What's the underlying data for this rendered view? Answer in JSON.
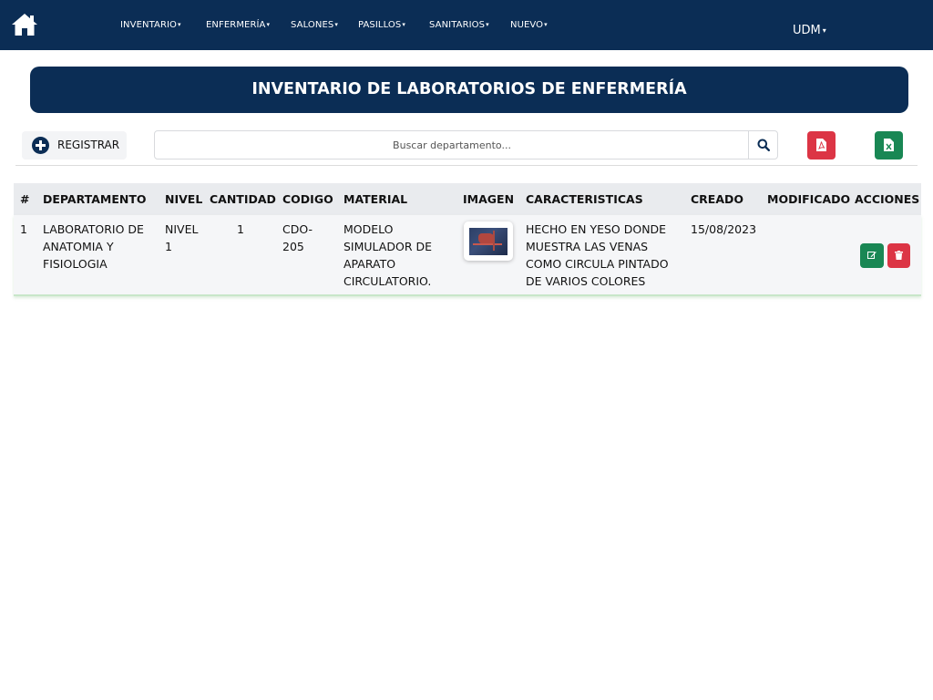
{
  "navbar": {
    "home_icon": "home-icon",
    "items": [
      {
        "label": "INVENTARIO"
      },
      {
        "label": "ENFERMERÍA"
      },
      {
        "label": "SALONES"
      },
      {
        "label": "PASILLOS"
      },
      {
        "label": "SANITARIOS"
      },
      {
        "label": "NUEVO"
      }
    ],
    "user": "UDM",
    "caret": "▾"
  },
  "banner": {
    "title": "INVENTARIO DE LABORATORIOS DE ENFERMERÍA"
  },
  "toolbar": {
    "register_label": "REGISTRAR",
    "register_icon": "plus-circle-icon",
    "search_placeholder": "Buscar departamento...",
    "search_icon": "search-icon",
    "pdf_icon": "file-pdf-icon",
    "excel_icon": "file-excel-icon"
  },
  "table": {
    "headers": [
      "#",
      "DEPARTAMENTO",
      "NIVEL",
      "CANTIDAD",
      "CODIGO",
      "MATERIAL",
      "IMAGEN",
      "CARACTERISTICAS",
      "CREADO",
      "MODIFICADO",
      "ACCIONES"
    ],
    "rows": [
      {
        "index": "1",
        "departamento": [
          "LABORATORIO DE",
          "ANATOMIA Y",
          "FISIOLOGIA"
        ],
        "nivel": [
          "NIVEL",
          "1"
        ],
        "cantidad": "1",
        "codigo": [
          "CDO-",
          "205"
        ],
        "material": [
          "MODELO",
          "SIMULADOR DE",
          "APARATO",
          "CIRCULATORIO."
        ],
        "imagen": "circulatory-model-thumbnail",
        "caracteristicas": [
          "HECHO EN YESO DONDE",
          "MUESTRA LAS VENAS",
          "COMO CIRCULA PINTADO",
          "DE VARIOS COLORES"
        ],
        "creado": "15/08/2023",
        "modificado": "",
        "edit_icon": "edit-icon",
        "delete_icon": "trash-icon"
      }
    ]
  },
  "colors": {
    "navy": "#0b2d55",
    "danger": "#dc3545",
    "success": "#198754"
  }
}
